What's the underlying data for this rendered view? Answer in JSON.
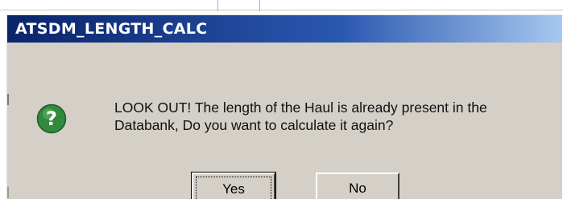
{
  "dialog": {
    "title": "ATSDM_LENGTH_CALC",
    "icon": "question-icon",
    "icon_glyph": "?",
    "message_line1": "LOOK OUT! The length of the Haul is already present in the",
    "message_line2": "Databank, Do you want to calculate it again?",
    "buttons": {
      "yes": "Yes",
      "no": "No"
    },
    "colors": {
      "titlebar_start": "#0a246a",
      "titlebar_end": "#a6c8f0",
      "face": "#d4d0c8",
      "icon_green": "#2f8a3c"
    }
  }
}
